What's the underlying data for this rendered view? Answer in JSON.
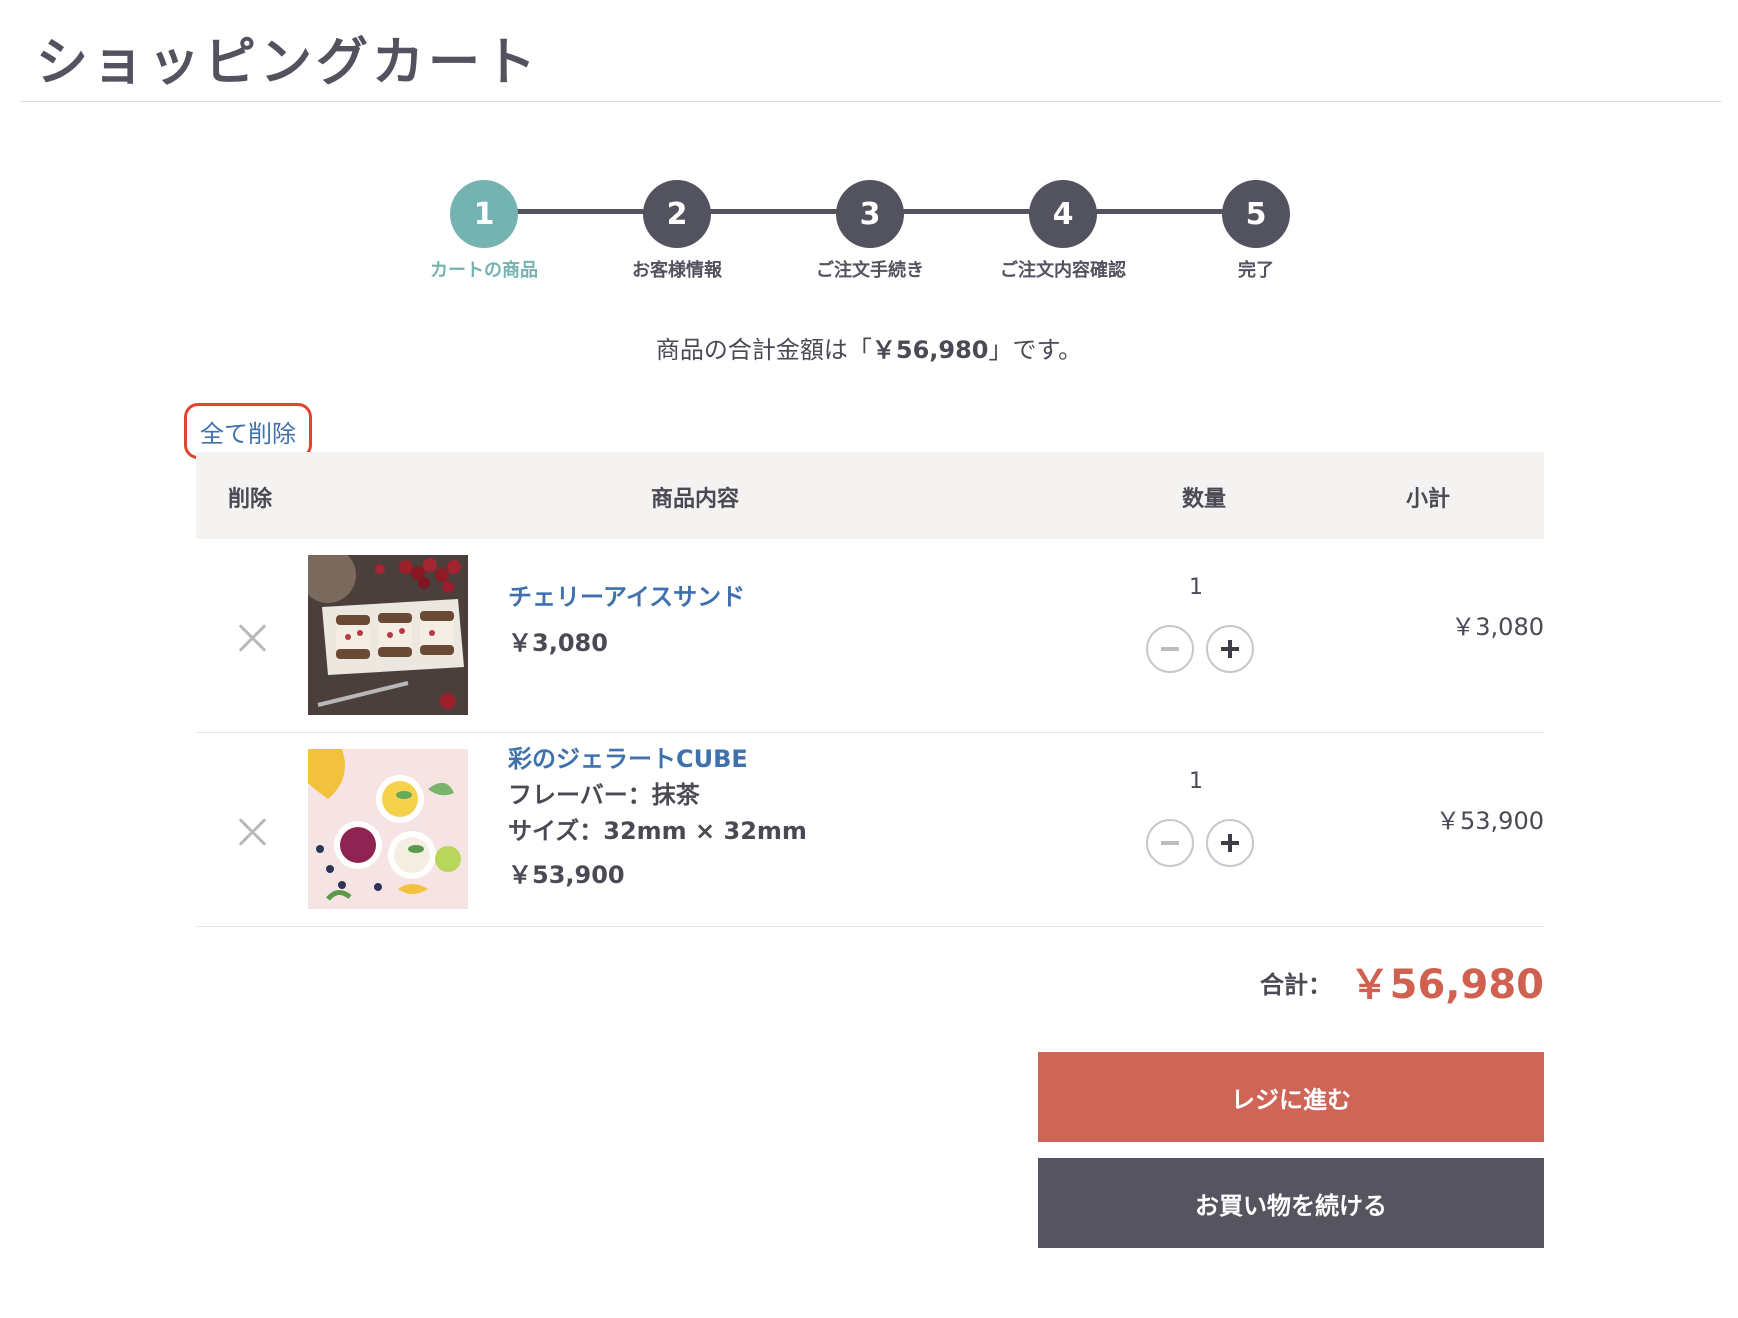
{
  "page": {
    "title": "ショッピングカート"
  },
  "stepper": {
    "steps": [
      {
        "number": "1",
        "label": "カートの商品",
        "active": true
      },
      {
        "number": "2",
        "label": "お客様情報",
        "active": false
      },
      {
        "number": "3",
        "label": "ご注文手続き",
        "active": false
      },
      {
        "number": "4",
        "label": "ご注文内容確認",
        "active": false
      },
      {
        "number": "5",
        "label": "完了",
        "active": false
      }
    ]
  },
  "summary": {
    "prefix": "商品の合計金額は「",
    "amount": "￥56,980",
    "suffix": "」です。"
  },
  "clear_all": {
    "label": "全て削除"
  },
  "table": {
    "headers": {
      "remove": "削除",
      "item": "商品内容",
      "quantity": "数量",
      "subtotal": "小計"
    },
    "rows": [
      {
        "name": "チェリーアイスサンド",
        "details": [],
        "price": "￥3,080",
        "quantity": "1",
        "subtotal": "￥3,080",
        "image": "cherry-ice-sandwich-photo"
      },
      {
        "name": "彩のジェラートCUBE",
        "details": [
          "フレーバー：抹茶",
          "サイズ：32mm × 32mm"
        ],
        "price": "￥53,900",
        "quantity": "1",
        "subtotal": "￥53,900",
        "image": "gelato-cube-photo"
      }
    ]
  },
  "total": {
    "label": "合計：",
    "amount": "￥56,980"
  },
  "buttons": {
    "checkout": "レジに進む",
    "continue": "お買い物を続ける"
  },
  "colors": {
    "accent_teal": "#74b3b0",
    "dark": "#53535f",
    "link_blue": "#3f72ad",
    "price_red": "#d0604f",
    "checkout_red": "#cf6557",
    "highlight_red": "#e0452d"
  }
}
